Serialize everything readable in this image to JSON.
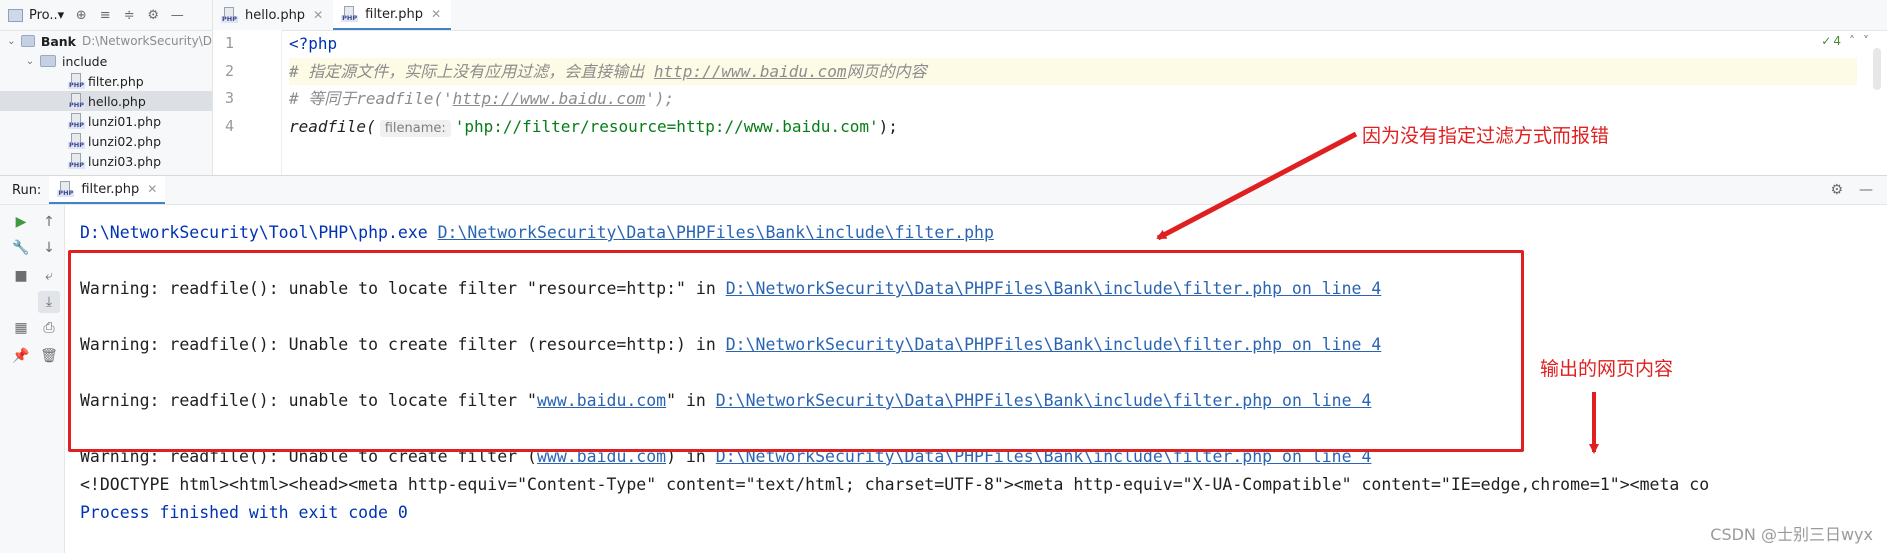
{
  "project": {
    "title": "Pro..▾",
    "root": {
      "name": "Bank",
      "path": "D:\\NetworkSecurity\\D"
    },
    "folder": "include",
    "files": [
      "filter.php",
      "hello.php",
      "lunzi01.php",
      "lunzi02.php",
      "lunzi03.php"
    ],
    "selected": "hello.php"
  },
  "editor": {
    "tabs": [
      {
        "label": "hello.php",
        "active": false
      },
      {
        "label": "filter.php",
        "active": true
      }
    ],
    "line_numbers": [
      "1",
      "2",
      "3",
      "4"
    ],
    "code": {
      "l1": "<?php",
      "l2_prefix": "# 指定源文件，实际上没有应用过滤，会直接输出 ",
      "l2_url": "http://www.baidu.com",
      "l2_suffix": "网页的内容",
      "l3_prefix": "# 等同于readfile('",
      "l3_url": "http://www.baidu.com",
      "l3_suffix": "');",
      "l4_fn": "readfile(",
      "l4_hint": "filename:",
      "l4_arg": "'php://filter/resource=http://www.baidu.com'",
      "l4_end": ");"
    },
    "inspection_count": "4"
  },
  "run": {
    "label": "Run:",
    "tab": "filter.php",
    "cmd_exe": "D:\\NetworkSecurity\\Tool\\PHP\\php.exe",
    "cmd_file": "D:\\NetworkSecurity\\Data\\PHPFiles\\Bank\\include\\filter.php",
    "warnings": [
      {
        "text": "Warning: readfile(): unable to locate filter \"resource=http:\" in ",
        "link": "D:\\NetworkSecurity\\Data\\PHPFiles\\Bank\\include\\filter.php on line 4"
      },
      {
        "text": "Warning: readfile(): Unable to create filter (resource=http:) in ",
        "link": "D:\\NetworkSecurity\\Data\\PHPFiles\\Bank\\include\\filter.php on line 4"
      },
      {
        "pre": "Warning: readfile(): unable to locate filter \"",
        "url": "www.baidu.com",
        "post": "\" in ",
        "link": "D:\\NetworkSecurity\\Data\\PHPFiles\\Bank\\include\\filter.php on line 4"
      },
      {
        "pre": "Warning: readfile(): Unable to create filter (",
        "url": "www.baidu.com",
        "post": ") in ",
        "link": "D:\\NetworkSecurity\\Data\\PHPFiles\\Bank\\include\\filter.php on line 4"
      }
    ],
    "html_output": "<!DOCTYPE html><html><head><meta http-equiv=\"Content-Type\" content=\"text/html; charset=UTF-8\"><meta http-equiv=\"X-UA-Compatible\" content=\"IE=edge,chrome=1\"><meta co",
    "finished": "Process finished with exit code 0"
  },
  "annotations": {
    "error_note": "因为没有指定过滤方式而报错",
    "output_note": "输出的网页内容",
    "color": "#e02020"
  },
  "watermark": "CSDN @士别三日wyx"
}
